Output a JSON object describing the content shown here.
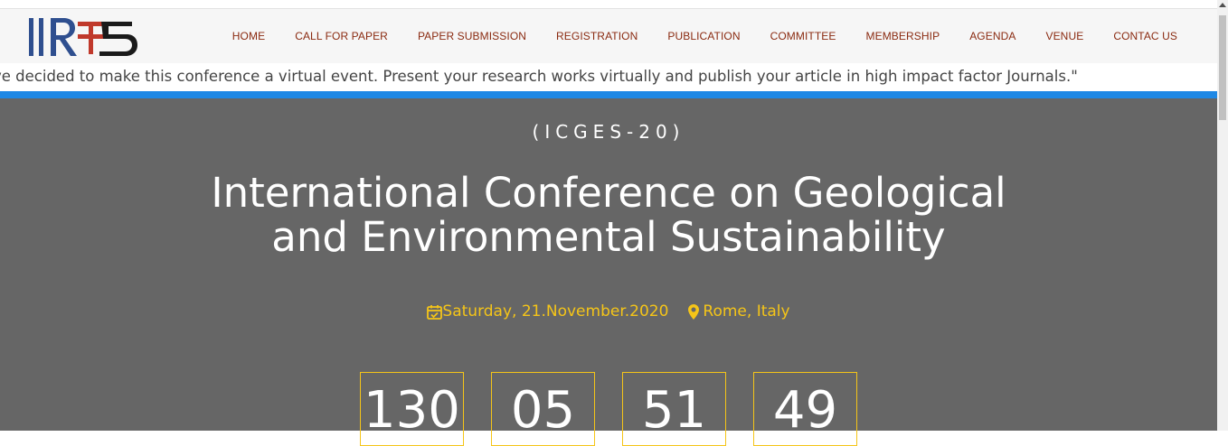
{
  "logo": {
    "text": "IIRSTS"
  },
  "nav": {
    "items": [
      "HOME",
      "CALL FOR PAPER",
      "PAPER SUBMISSION",
      "REGISTRATION",
      "PUBLICATION",
      "COMMITTEE",
      "MEMBERSHIP",
      "AGENDA",
      "VENUE",
      "CONTAC US"
    ]
  },
  "marquee": {
    "text": "ve decided to make this conference a virtual event. Present your research works virtually and publish your article in high impact factor Journals.\""
  },
  "hero": {
    "abbr": "(ICGES-20)",
    "title_line1": "International Conference on Geological",
    "title_line2": "and Environmental Sustainability",
    "date": "Saturday, 21.November.2020",
    "location": "Rome, Italy"
  },
  "countdown": [
    "130",
    "05",
    "51",
    "49"
  ],
  "colors": {
    "accent": "#f5c518",
    "nav_text": "#8a2a10",
    "hero_bg": "#666666",
    "blue_bar": "#1e88e5"
  }
}
